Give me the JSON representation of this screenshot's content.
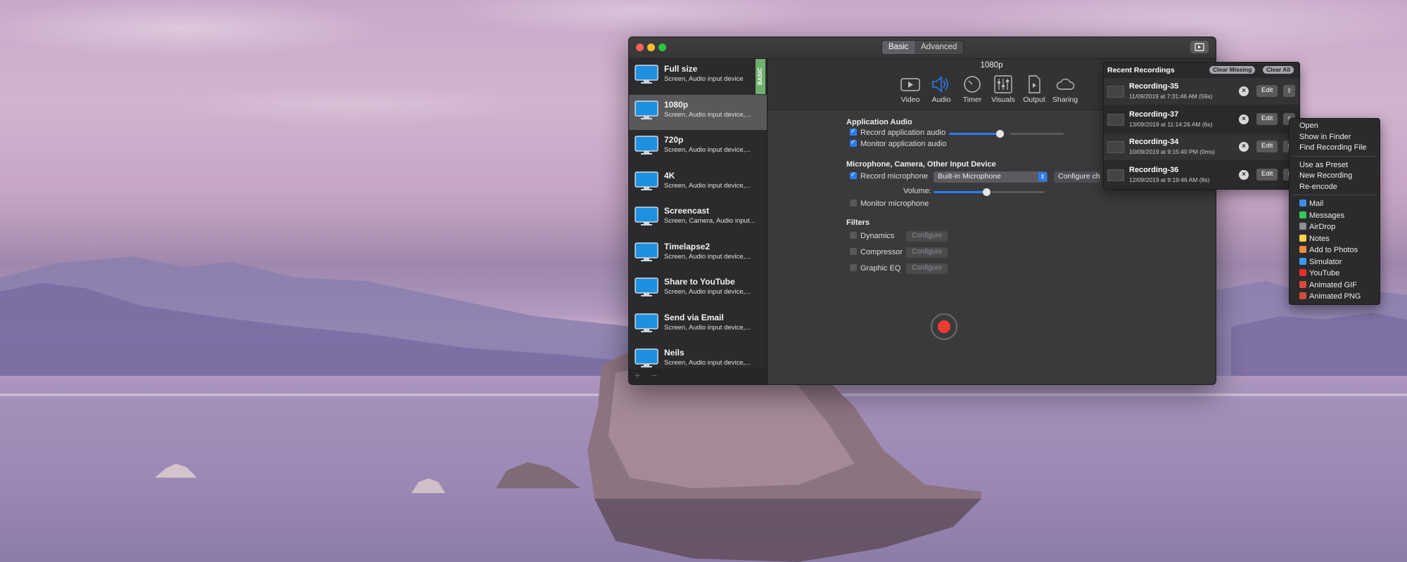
{
  "window": {
    "segments": [
      "Basic",
      "Advanced"
    ],
    "presets": [
      {
        "title": "Full size",
        "subtitle": "Screen, Audio input device",
        "tag": "BASIC"
      },
      {
        "title": "1080p",
        "subtitle": "Screen, Audio input device,..."
      },
      {
        "title": "720p",
        "subtitle": "Screen, Audio input device,..."
      },
      {
        "title": "4K",
        "subtitle": "Screen, Audio input device,..."
      },
      {
        "title": "Screencast",
        "subtitle": "Screen, Camera, Audio input..."
      },
      {
        "title": "Timelapse2",
        "subtitle": "Screen, Audio input device,..."
      },
      {
        "title": "Share to YouTube",
        "subtitle": "Screen, Audio input device,..."
      },
      {
        "title": "Send via Email",
        "subtitle": "Screen, Audio input device,..."
      },
      {
        "title": "Neils",
        "subtitle": "Screen, Audio input device,..."
      }
    ],
    "sidebar_footer": {
      "add": "+",
      "remove": "−"
    },
    "preset_title": "1080p",
    "toolbar": [
      "Video",
      "Audio",
      "Timer",
      "Visuals",
      "Output",
      "Sharing"
    ],
    "app_audio": {
      "heading": "Application Audio",
      "record_label": "Record application audio",
      "record_checked": true,
      "record_level": 0.75,
      "monitor_label": "Monitor application audio",
      "monitor_checked": true
    },
    "mic": {
      "heading": "Microphone, Camera, Other Input Device",
      "record_label": "Record microphone",
      "record_checked": true,
      "device": "Built-in Microphone",
      "configure_label": "Configure ch",
      "volume_label": "Volume:",
      "volume_level": 0.75,
      "monitor_label": "Monitor microphone",
      "monitor_checked": false
    },
    "filters": {
      "heading": "Filters",
      "items": [
        {
          "label": "Dynamics",
          "button": "Configure"
        },
        {
          "label": "Compressor",
          "button": "Configure"
        },
        {
          "label": "Graphic EQ",
          "button": "Configure"
        }
      ]
    }
  },
  "recent": {
    "title": "Recent Recordings",
    "clear_missing": "Clear Missing",
    "clear_all": "Clear All",
    "items": [
      {
        "name": "Recording-35",
        "date": "11/09/2019 at 7:31:46 AM (59s)",
        "edit": "Edit"
      },
      {
        "name": "Recording-37",
        "date": "13/09/2019 at 11:14:26 AM (6s)",
        "edit": "Edit"
      },
      {
        "name": "Recording-34",
        "date": "10/09/2019 at 9:15:40 PM (0ms)",
        "edit": "Edit"
      },
      {
        "name": "Recording-36",
        "date": "12/09/2019 at 9:19:46 AM (8s)",
        "edit": "Edit"
      }
    ]
  },
  "context_menu": {
    "group1": [
      "Open",
      "Show in Finder",
      "Find Recording File"
    ],
    "group2": [
      "Use as Preset",
      "New Recording",
      "Re-encode"
    ],
    "share": [
      {
        "label": "Mail",
        "color": "#3b8fe8"
      },
      {
        "label": "Messages",
        "color": "#33c759"
      },
      {
        "label": "AirDrop",
        "color": "#8e8e93"
      },
      {
        "label": "Notes",
        "color": "#f5d24b"
      },
      {
        "label": "Add to Photos",
        "color": "#f08a3c"
      },
      {
        "label": "Simulator",
        "color": "#3a9cf0"
      },
      {
        "label": "YouTube",
        "color": "#e8302a"
      },
      {
        "label": "Animated GIF",
        "color": "#d94a3a"
      },
      {
        "label": "Animated PNG",
        "color": "#d94a3a"
      }
    ]
  }
}
